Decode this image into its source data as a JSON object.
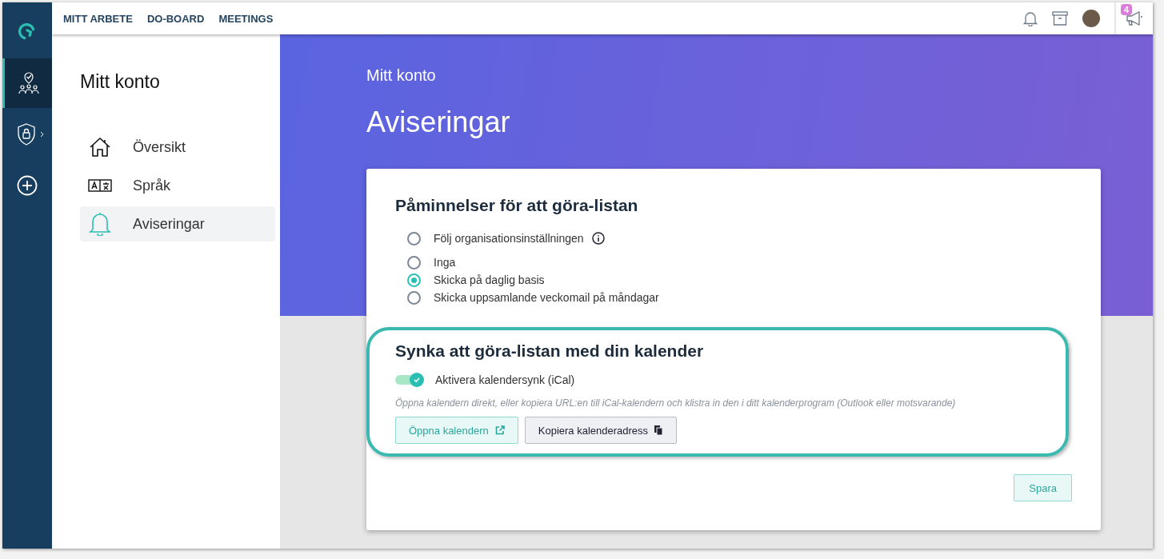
{
  "top_nav": {
    "links": [
      {
        "label": "MITT ARBETE"
      },
      {
        "label": "DO-BOARD"
      },
      {
        "label": "MEETINGS"
      }
    ],
    "announcements_badge": "4"
  },
  "rail": {
    "items": [
      {
        "kind": "team",
        "selected": true
      },
      {
        "kind": "security",
        "selected": false
      },
      {
        "kind": "add",
        "selected": false
      }
    ]
  },
  "sidebar": {
    "title": "Mitt konto",
    "items": [
      {
        "label": "Översikt",
        "kind": "home",
        "selected": false
      },
      {
        "label": "Språk",
        "kind": "language",
        "selected": false
      },
      {
        "label": "Aviseringar",
        "kind": "bell",
        "selected": true
      }
    ]
  },
  "header": {
    "breadcrumb": "Mitt konto",
    "title": "Aviseringar"
  },
  "reminders": {
    "title": "Påminnelser för att göra-listan",
    "options": [
      {
        "label": "Följ organisationsinställningen",
        "info": true,
        "selected": false
      },
      {
        "label": "Inga",
        "info": false,
        "selected": false
      },
      {
        "label": "Skicka på daglig basis",
        "info": false,
        "selected": true
      },
      {
        "label": "Skicka uppsamlande veckomail på måndagar",
        "info": false,
        "selected": false
      }
    ]
  },
  "sync": {
    "title": "Synka att göra-listan med din kalender",
    "toggle_label": "Aktivera kalendersynk (iCal)",
    "enabled": true,
    "hint": "Öppna kalendern direkt, eller kopiera URL:en till iCal-kalendern och klistra in den i ditt kalenderprogram (Outlook eller motsvarande)",
    "open_button": "Öppna kalendern",
    "copy_button": "Kopiera kalenderadress",
    "highlighted": true
  },
  "save_button": "Spara"
}
